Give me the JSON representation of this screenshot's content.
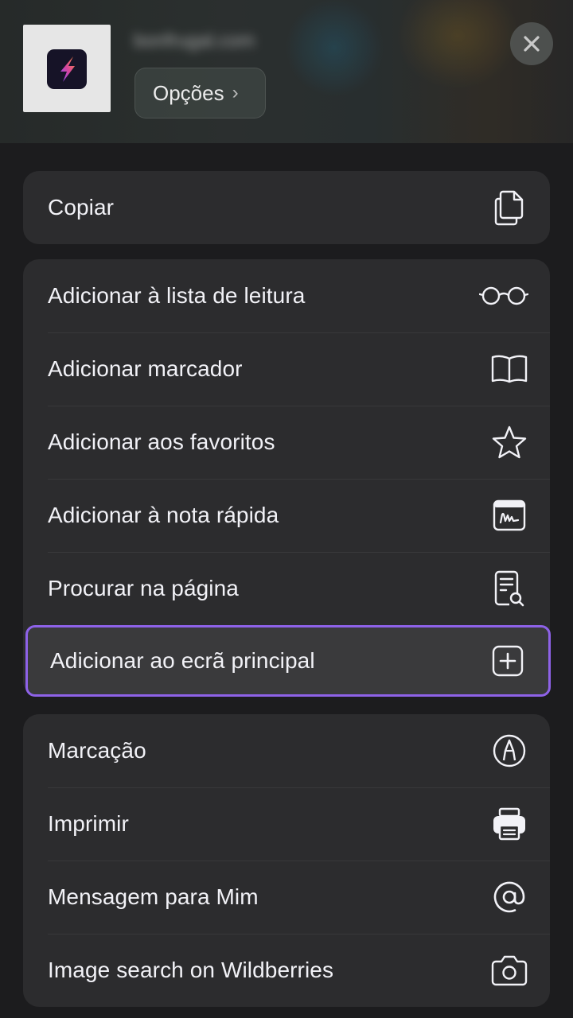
{
  "header": {
    "site_url": "bonfrugal.com",
    "options_label": "Opções",
    "options_chevron": "›",
    "close_icon": "close-icon",
    "app_icon": "lightning-app-icon"
  },
  "groups": [
    {
      "items": [
        {
          "label": "Copiar",
          "icon": "copy-icon"
        }
      ]
    },
    {
      "items": [
        {
          "label": "Adicionar à lista de leitura",
          "icon": "glasses-icon"
        },
        {
          "label": "Adicionar marcador",
          "icon": "book-icon"
        },
        {
          "label": "Adicionar aos favoritos",
          "icon": "star-icon"
        },
        {
          "label": "Adicionar à nota rápida",
          "icon": "quick-note-icon"
        },
        {
          "label": "Procurar na página",
          "icon": "find-in-page-icon"
        },
        {
          "label": "Adicionar ao ecrã principal",
          "icon": "add-square-icon",
          "highlighted": true
        }
      ]
    },
    {
      "items": [
        {
          "label": "Marcação",
          "icon": "markup-pen-icon"
        },
        {
          "label": "Imprimir",
          "icon": "printer-icon"
        },
        {
          "label": "Mensagem para Mim",
          "icon": "at-icon"
        },
        {
          "label": "Image search on Wildberries",
          "icon": "camera-icon"
        }
      ]
    }
  ],
  "colors": {
    "highlight_border": "#8e62e8",
    "group_bg": "#2c2c2e",
    "page_bg": "#1c1c1e"
  }
}
